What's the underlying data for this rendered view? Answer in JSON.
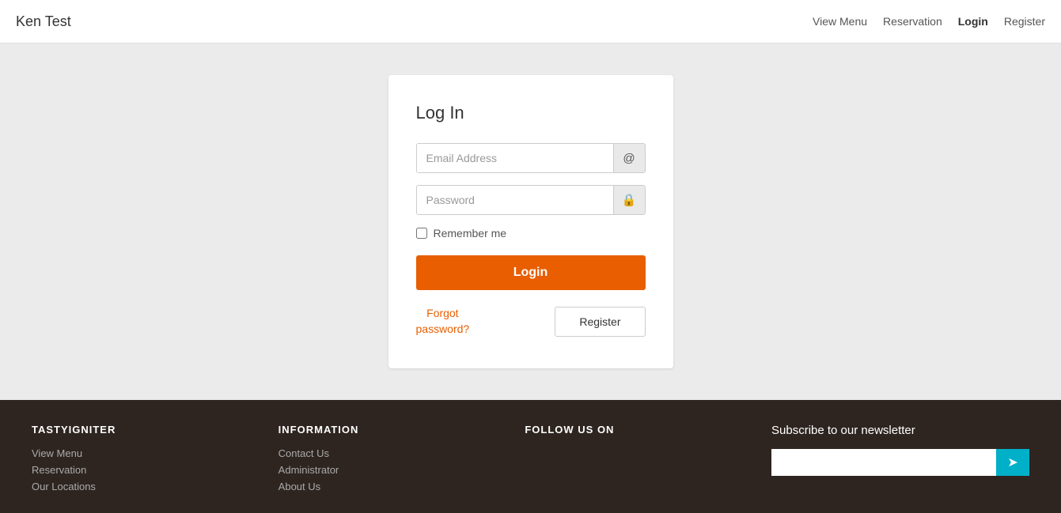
{
  "header": {
    "logo": "Ken Test",
    "nav": [
      {
        "label": "View Menu",
        "active": false
      },
      {
        "label": "Reservation",
        "active": false
      },
      {
        "label": "Login",
        "active": true
      },
      {
        "label": "Register",
        "active": false
      }
    ]
  },
  "login_card": {
    "title": "Log In",
    "email_placeholder": "Email Address",
    "password_placeholder": "Password",
    "remember_label": "Remember me",
    "login_button": "Login",
    "forgot_password": "Forgot\npassword?",
    "register_button": "Register",
    "email_icon": "@",
    "lock_icon": "🔒"
  },
  "footer": {
    "col1": {
      "title": "TASTYIGNITER",
      "links": [
        "View Menu",
        "Reservation",
        "Our Locations"
      ]
    },
    "col2": {
      "title": "INFORMATION",
      "links": [
        "Contact Us",
        "Administrator",
        "About Us"
      ]
    },
    "col3": {
      "title": "FOLLOW US ON",
      "links": []
    },
    "col4": {
      "title": "Subscribe to our newsletter",
      "input_placeholder": "",
      "button_icon": "➤"
    }
  }
}
